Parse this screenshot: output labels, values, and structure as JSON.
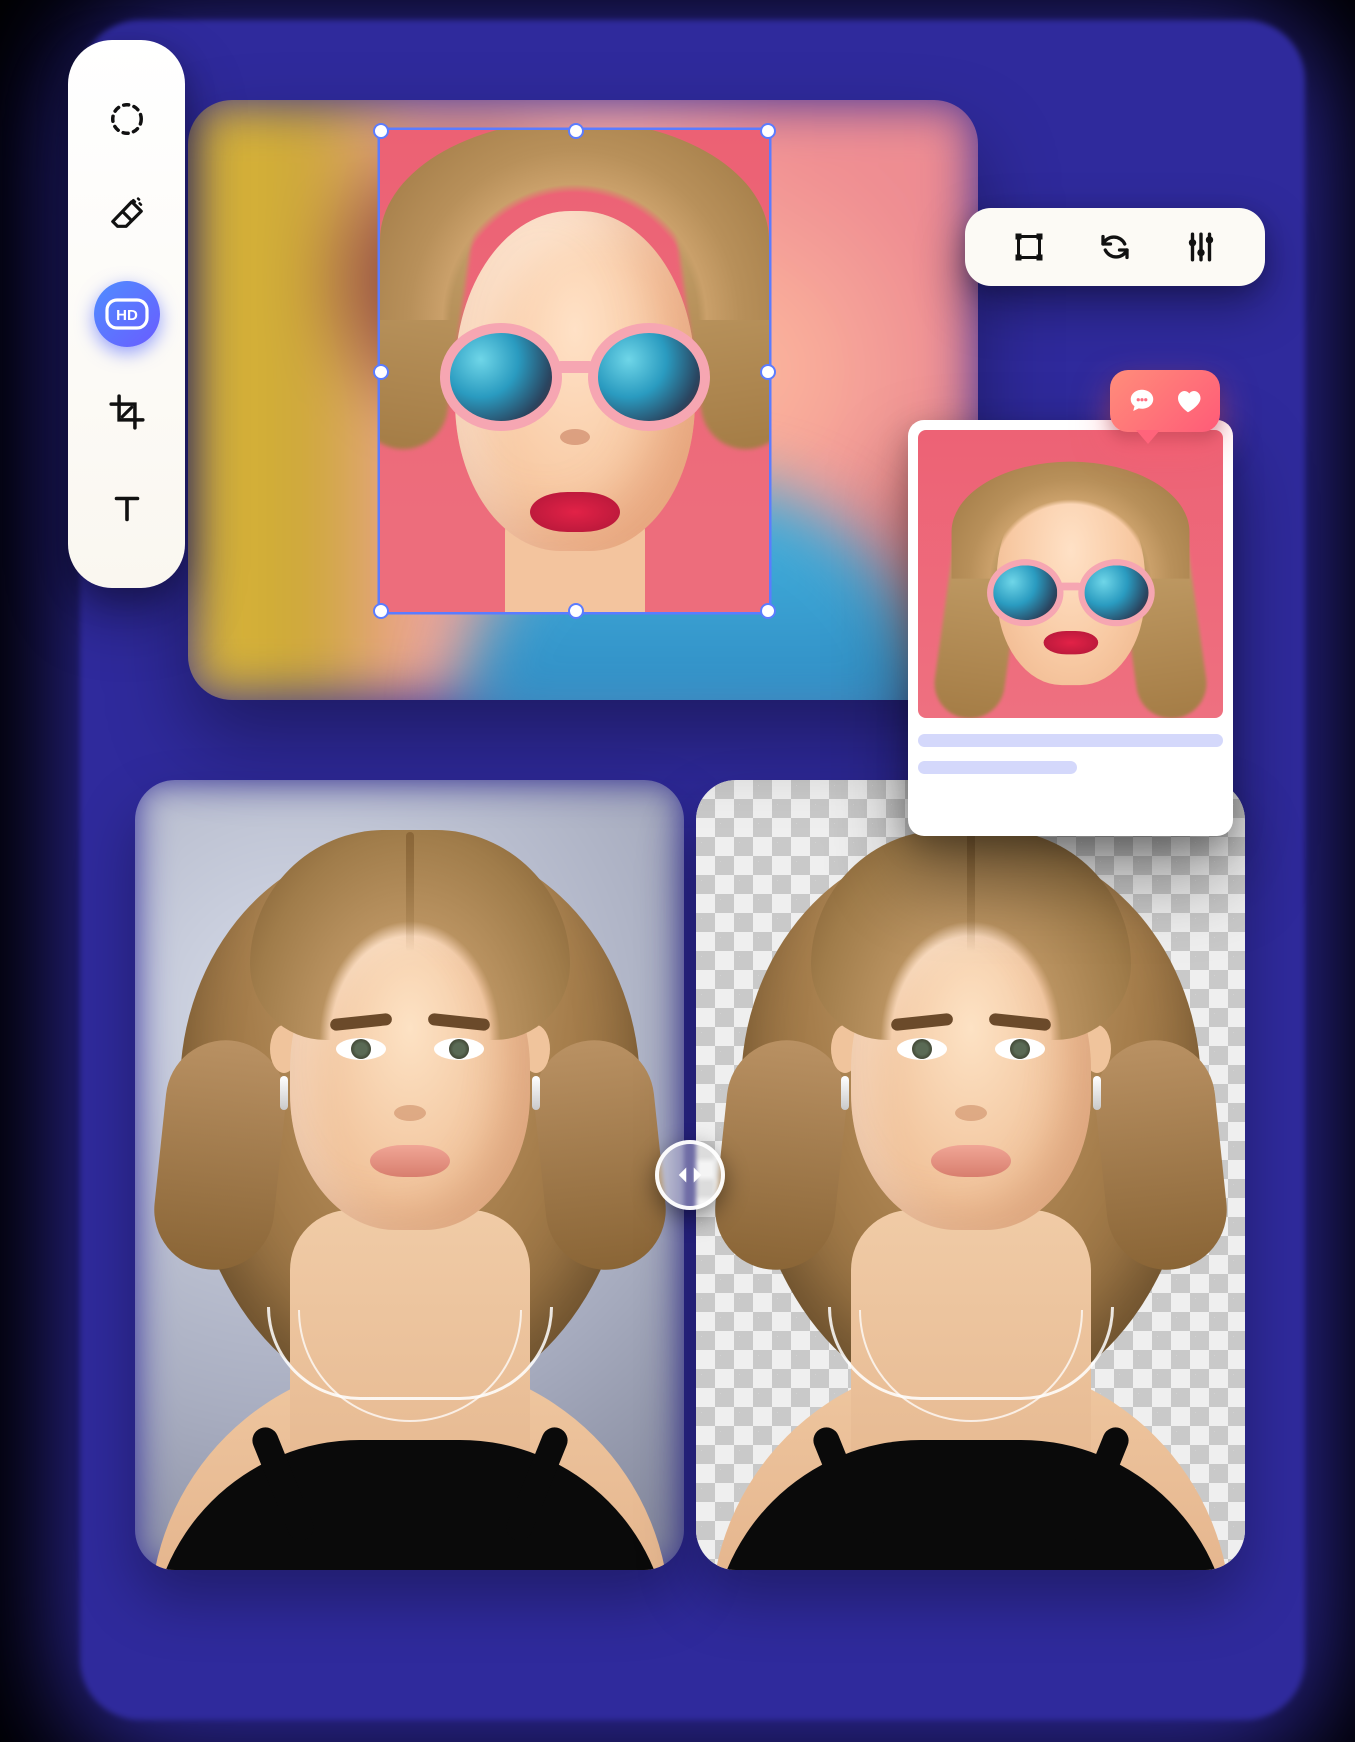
{
  "vtoolbar": {
    "items": [
      {
        "name": "magic-select-tool",
        "icon": "dashed-circle-icon",
        "active": false
      },
      {
        "name": "eraser-tool",
        "icon": "eraser-icon",
        "active": false
      },
      {
        "name": "hd-enhance-tool",
        "icon": "hd-badge-icon",
        "active": true,
        "label": "HD"
      },
      {
        "name": "crop-tool",
        "icon": "crop-icon",
        "active": false
      },
      {
        "name": "text-tool",
        "icon": "text-icon",
        "active": false
      }
    ]
  },
  "htoolbar": {
    "items": [
      {
        "name": "transform-tool",
        "icon": "bounding-box-icon"
      },
      {
        "name": "rotate-tool",
        "icon": "rotate-icon"
      },
      {
        "name": "adjust-tool",
        "icon": "sliders-icon"
      }
    ]
  },
  "canvas": {
    "selection": {
      "visible": true,
      "handles": 8
    }
  },
  "social_bubble": {
    "icons": [
      "comment-icon",
      "heart-icon"
    ]
  },
  "preview_card": {
    "placeholder_lines": 2
  },
  "comparison": {
    "left": {
      "background": "original"
    },
    "right": {
      "background": "transparent-checker"
    },
    "slider": {
      "position_pct": 50
    }
  },
  "colors": {
    "surface": "#2f2a9c",
    "toolbar": "#fcfaf5",
    "accent_gradient": [
      "#4f8dff",
      "#6a5cff"
    ],
    "selection": "#5b7cff",
    "bubble_gradient": [
      "#ff8d7a",
      "#ff5b78"
    ],
    "placeholder": "#d4d8fb"
  }
}
